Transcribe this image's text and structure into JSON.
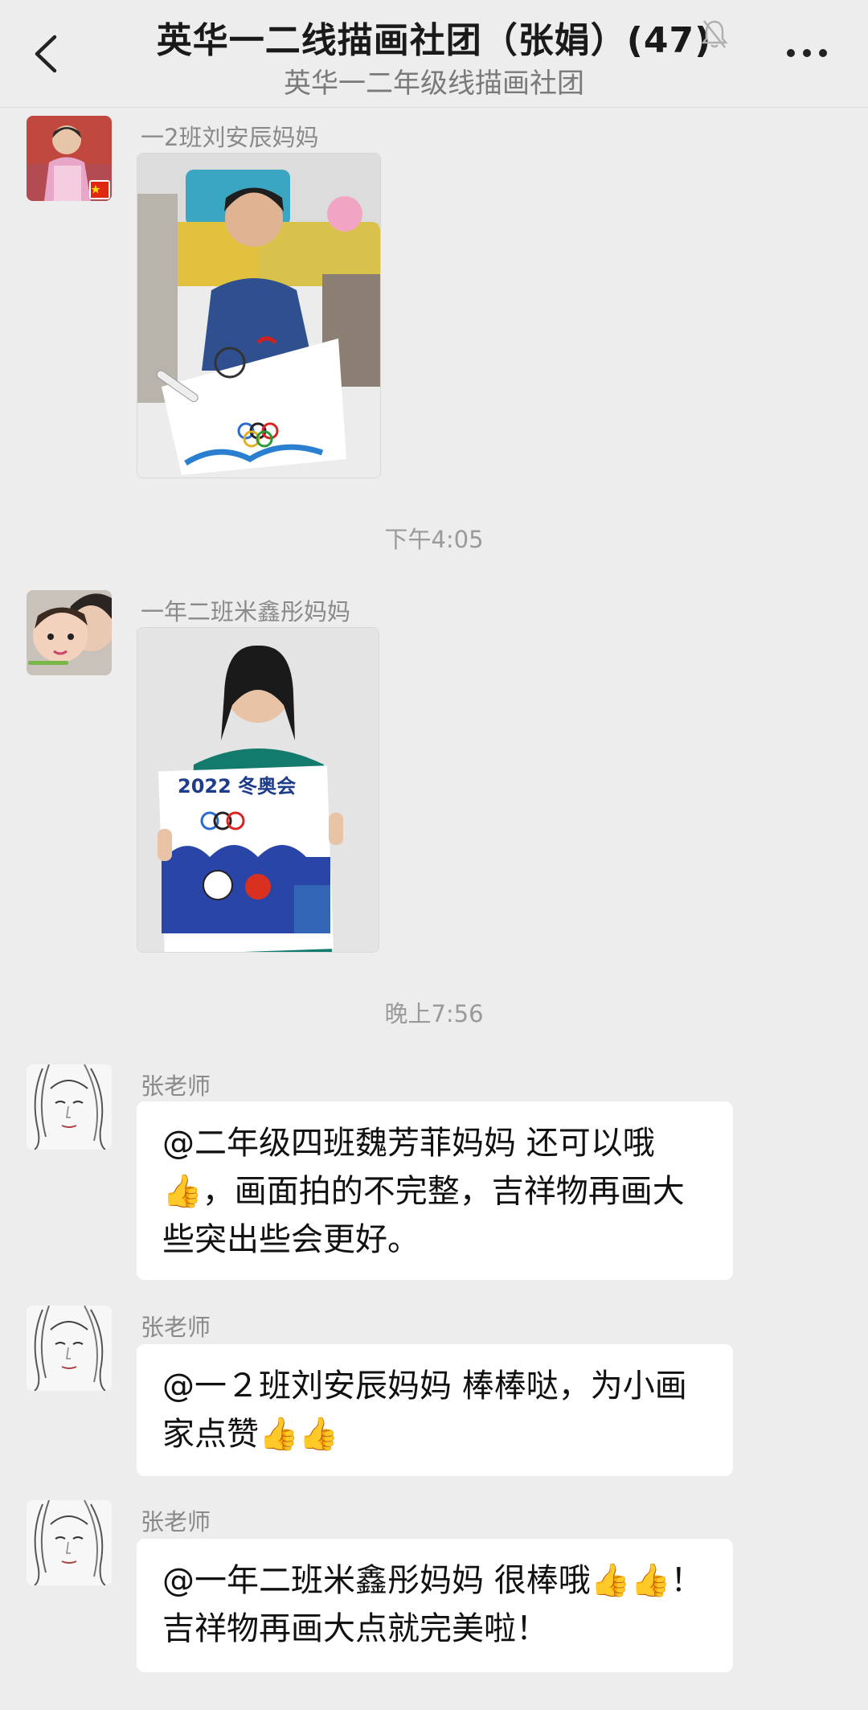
{
  "header": {
    "title": "英华一二线描画社团（张娟）(47)",
    "subtitle": "英华一二年级线描画社团",
    "icons": [
      "back-arrow-icon",
      "mute-bell-icon",
      "more-dots-icon"
    ]
  },
  "messages": [
    {
      "sender": "一2班刘安辰妈妈",
      "type": "image"
    },
    {
      "sender": "一年二班米鑫彤妈妈",
      "type": "image",
      "poster_text": "2022 冬奥会"
    },
    {
      "sender": "张老师",
      "type": "text",
      "text": "@二年级四班魏芳菲妈妈  还可以哦👍，画面拍的不完整，吉祥物再画大些突出些会更好。"
    },
    {
      "sender": "张老师",
      "type": "text",
      "text": "@一２班刘安辰妈妈  棒棒哒，为小画家点赞👍👍"
    },
    {
      "sender": "张老师",
      "type": "text",
      "text": "@一年二班米鑫彤妈妈  很棒哦👍👍！ 吉祥物再画大点就完美啦！"
    }
  ],
  "timestamps": [
    "下午4:05",
    "晚上7:56"
  ],
  "colors": {
    "background": "#ededed",
    "bubble": "#ffffff",
    "meta_text": "#8a8a8a"
  }
}
